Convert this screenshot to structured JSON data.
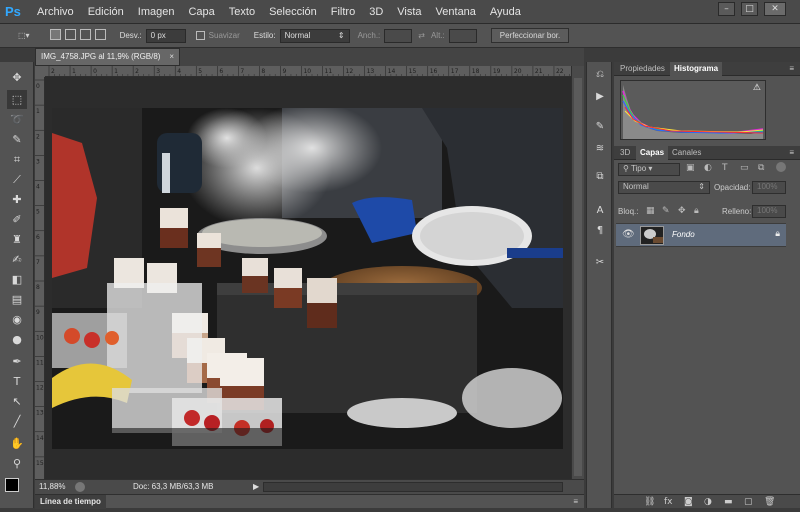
{
  "app": {
    "logo": "Ps"
  },
  "menu": [
    "Archivo",
    "Edición",
    "Imagen",
    "Capa",
    "Texto",
    "Selección",
    "Filtro",
    "3D",
    "Vista",
    "Ventana",
    "Ayuda"
  ],
  "window_controls": [
    "–",
    "□",
    "✕"
  ],
  "options": {
    "feather_label": "Desv.:",
    "feather_value": "0 px",
    "antialias_label": "Suavizar",
    "style_label": "Estilo:",
    "style_value": "Normal",
    "width_label": "Anch.:",
    "height_label": "Alt.:",
    "refine_button": "Perfeccionar bor."
  },
  "document": {
    "tab_title": "IMG_4758.JPG al 11,9% (RGB/8)",
    "close": "×",
    "zoom": "11,88%",
    "doc_info": "Doc: 63,3 MB/63,3 MB"
  },
  "timeline_tab": "Línea de tiempo",
  "ruler": {
    "top_ticks": [
      "2",
      "1",
      "0",
      "1",
      "2",
      "3",
      "4",
      "5",
      "6",
      "7",
      "8",
      "9",
      "10",
      "11",
      "12",
      "13",
      "14",
      "15",
      "16",
      "17",
      "18",
      "19",
      "20",
      "21",
      "22"
    ],
    "left_ticks": [
      "0",
      "1",
      "2",
      "3",
      "4",
      "5",
      "6",
      "7",
      "8",
      "9",
      "10",
      "11",
      "12",
      "13",
      "14",
      "15"
    ]
  },
  "panels": {
    "top_tabs": [
      "Propiedades",
      "Histograma"
    ],
    "top_active": 1,
    "layer_tabs": [
      "3D",
      "Capas",
      "Canales"
    ],
    "layer_active": 1,
    "kind_label": "Tipo",
    "blend_mode": "Normal",
    "opacity_label": "Opacidad:",
    "opacity_value": "100%",
    "lock_label": "Bloq.:",
    "fill_label": "Relleno:",
    "fill_value": "100%",
    "layers": [
      {
        "name": "Fondo"
      }
    ],
    "warning_glyph": "⚠"
  },
  "colors": {
    "accent": "#31a8ff",
    "selected_layer": "#5f6b7c"
  },
  "icons": {
    "tools": [
      "move-icon",
      "marquee-icon",
      "lasso-icon",
      "quick-select-icon",
      "crop-icon",
      "eyedropper-icon",
      "healing-brush-icon",
      "brush-icon",
      "clone-stamp-icon",
      "history-brush-icon",
      "eraser-icon",
      "gradient-icon",
      "blur-icon",
      "dodge-icon",
      "pen-icon",
      "type-icon",
      "path-select-icon",
      "line-icon",
      "hand-icon",
      "zoom-icon"
    ]
  }
}
